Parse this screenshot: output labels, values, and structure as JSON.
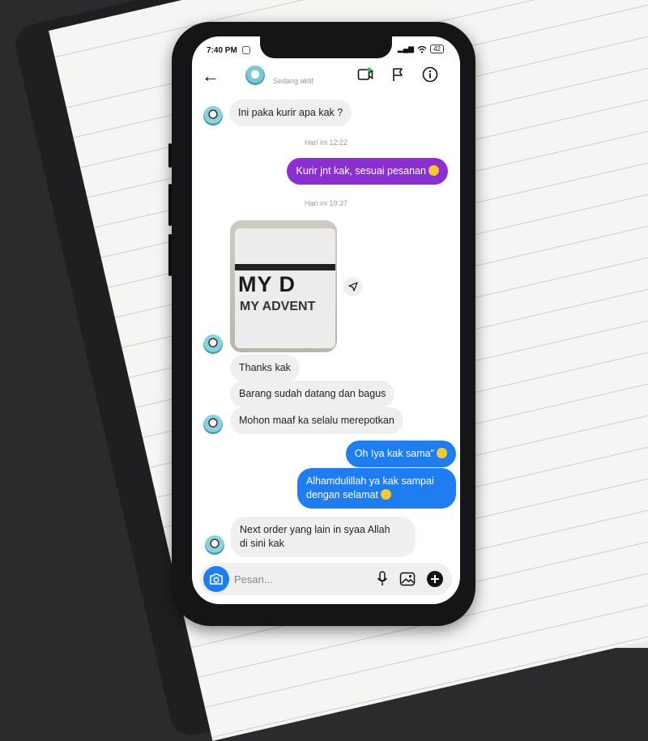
{
  "status_bar": {
    "time": "7:40 PM",
    "signal": "▂▄▆",
    "wifi": "wifi",
    "battery": "42"
  },
  "header": {
    "status_text": "Sedang aktif",
    "icons": [
      "back-arrow-icon",
      "video-call-icon",
      "flag-icon",
      "info-icon"
    ]
  },
  "messages": [
    {
      "text": "Ini paka kurir apa kak ?"
    },
    {
      "text": "Kurir jnt kak, sesuai pesanan"
    },
    {
      "text": "Thanks kak"
    },
    {
      "text": "Barang sudah datang dan bagus"
    },
    {
      "text": "Mohon maaf ka selalu merepotkan"
    },
    {
      "text": "Oh Iya kak sama\""
    },
    {
      "line1": "Alhamdulillah ya kak sampai",
      "line2": "dengan selamat"
    },
    {
      "line1": "Next order yang lain in syaa Allah",
      "line2": "di sini kak"
    }
  ],
  "timestamps": [
    "Hari ini 12:22",
    "Hari ini 19:37"
  ],
  "photo": {
    "line1": "MY D",
    "line2": "MY ADVENT"
  },
  "composer": {
    "placeholder": "Pesan..."
  },
  "colors": {
    "purple": "#8b2fd1",
    "blue": "#1f7df0",
    "incoming": "#efefef"
  }
}
